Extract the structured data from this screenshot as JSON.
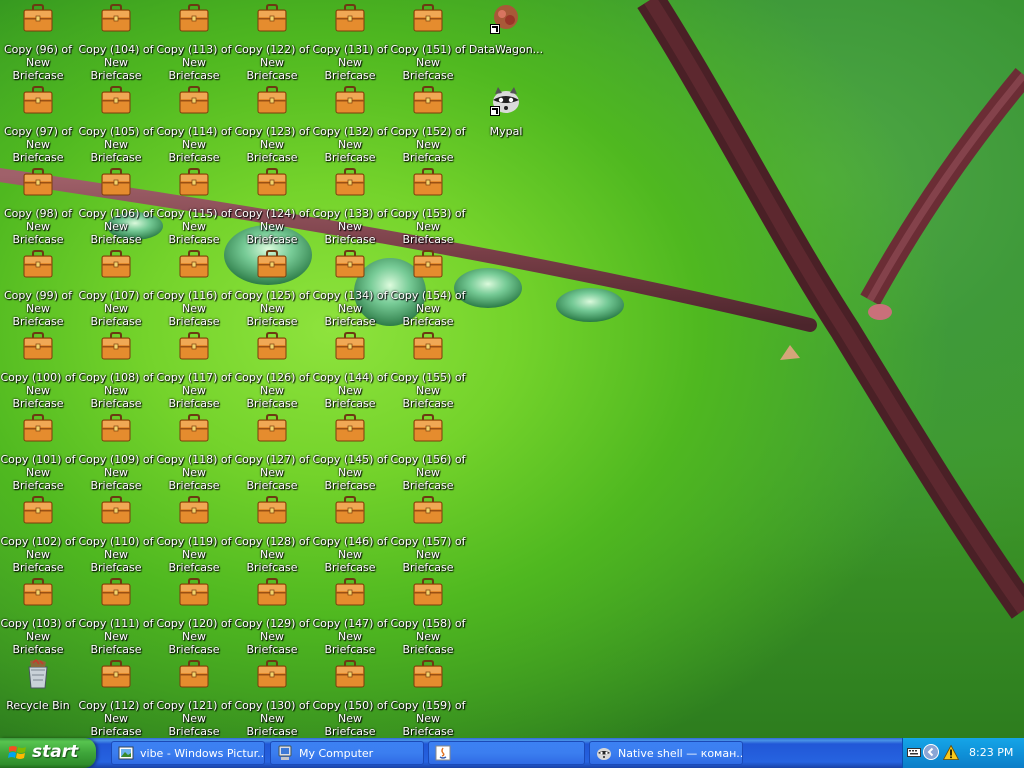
{
  "desktop": {
    "columns": [
      [
        "Copy (96) of New Briefcase",
        "Copy (97) of New Briefcase",
        "Copy (98) of New Briefcase",
        "Copy (99) of New Briefcase",
        "Copy (100) of New Briefcase",
        "Copy (101) of New Briefcase",
        "Copy (102) of New Briefcase",
        "Copy (103) of New Briefcase"
      ],
      [
        "Copy (104) of New Briefcase",
        "Copy (105) of New Briefcase",
        "Copy (106) of New Briefcase",
        "Copy (107) of New Briefcase",
        "Copy (108) of New Briefcase",
        "Copy (109) of New Briefcase",
        "Copy (110) of New Briefcase",
        "Copy (111) of New Briefcase",
        "Copy (112) of New Briefcase"
      ],
      [
        "Copy (113) of New Briefcase",
        "Copy (114) of New Briefcase",
        "Copy (115) of New Briefcase",
        "Copy (116) of New Briefcase",
        "Copy (117) of New Briefcase",
        "Copy (118) of New Briefcase",
        "Copy (119) of New Briefcase",
        "Copy (120) of New Briefcase",
        "Copy (121) of New Briefcase"
      ],
      [
        "Copy (122) of New Briefcase",
        "Copy (123) of New Briefcase",
        "Copy (124) of New Briefcase",
        "Copy (125) of New Briefcase",
        "Copy (126) of New Briefcase",
        "Copy (127) of New Briefcase",
        "Copy (128) of New Briefcase",
        "Copy (129) of New Briefcase",
        "Copy (130) of New Briefcase"
      ],
      [
        "Copy (131) of New Briefcase",
        "Copy (132) of New Briefcase",
        "Copy (133) of New Briefcase",
        "Copy (134) of New Briefcase",
        "Copy (144) of New Briefcase",
        "Copy (145) of New Briefcase",
        "Copy (146) of New Briefcase",
        "Copy (147) of New Briefcase",
        "Copy (150) of New Briefcase"
      ],
      [
        "Copy (151) of New Briefcase",
        "Copy (152) of New Briefcase",
        "Copy (153) of New Briefcase",
        "Copy (154) of New Briefcase",
        "Copy (155) of New Briefcase",
        "Copy (156) of New Briefcase",
        "Copy (157) of New Briefcase",
        "Copy (158) of New Briefcase",
        "Copy (159) of New Briefcase"
      ]
    ],
    "recycle_bin": "Recycle Bin",
    "shortcuts": [
      "DataWagon...",
      "Mypal"
    ]
  },
  "taskbar": {
    "start_label": "start",
    "tasks": [
      {
        "label": "vibe - Windows Pictur...",
        "icon": "picture-viewer-icon"
      },
      {
        "label": "My Computer",
        "icon": "my-computer-icon"
      },
      {
        "label": "",
        "icon": "java-icon"
      },
      {
        "label": "Native shell — коман...",
        "icon": "raccoon-icon"
      }
    ],
    "clock": "8:23 PM",
    "tray_icons": [
      "keyboard-icon",
      "show-hidden-icon",
      "warning-icon"
    ]
  },
  "colors": {
    "taskbar_blue": "#245edc",
    "start_green": "#3ea53a",
    "tray_blue": "#0f92d9",
    "briefcase": "#e08a2e"
  }
}
